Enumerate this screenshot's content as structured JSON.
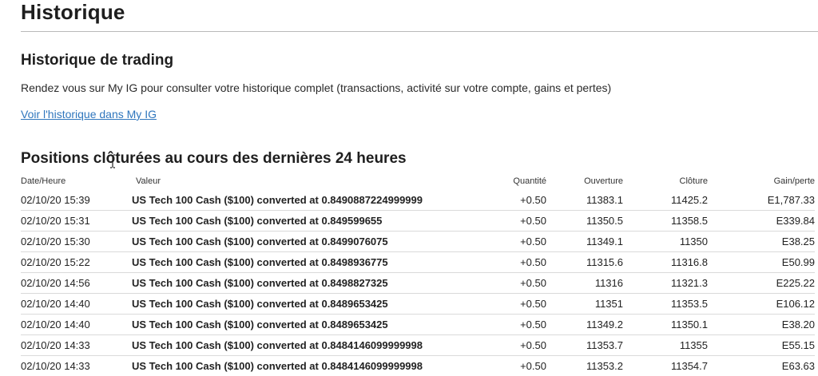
{
  "page": {
    "title": "Historique"
  },
  "trading_history": {
    "title": "Historique de trading",
    "description": "Rendez vous sur My IG pour consulter votre historique complet (transactions, activité sur votre compte, gains et pertes)",
    "link_label": "Voir l'historique dans My IG"
  },
  "positions": {
    "title": "Positions clôturées au cours des dernières 24 heures",
    "columns": {
      "date": "Date/Heure",
      "value": "Valeur",
      "quantity": "Quantité",
      "open": "Ouverture",
      "close": "Clôture",
      "gain": "Gain/perte"
    },
    "rows": [
      {
        "date": "02/10/20 15:39",
        "value": "US Tech 100 Cash ($100) converted at 0.8490887224999999",
        "quantity": "+0.50",
        "open": "11383.1",
        "close": "11425.2",
        "gain": "E1,787.33"
      },
      {
        "date": "02/10/20 15:31",
        "value": "US Tech 100 Cash ($100) converted at 0.849599655",
        "quantity": "+0.50",
        "open": "11350.5",
        "close": "11358.5",
        "gain": "E339.84"
      },
      {
        "date": "02/10/20 15:30",
        "value": "US Tech 100 Cash ($100) converted at 0.8499076075",
        "quantity": "+0.50",
        "open": "11349.1",
        "close": "11350",
        "gain": "E38.25"
      },
      {
        "date": "02/10/20 15:22",
        "value": "US Tech 100 Cash ($100) converted at 0.8498936775",
        "quantity": "+0.50",
        "open": "11315.6",
        "close": "11316.8",
        "gain": "E50.99"
      },
      {
        "date": "02/10/20 14:56",
        "value": "US Tech 100 Cash ($100) converted at 0.8498827325",
        "quantity": "+0.50",
        "open": "11316",
        "close": "11321.3",
        "gain": "E225.22"
      },
      {
        "date": "02/10/20 14:40",
        "value": "US Tech 100 Cash ($100) converted at 0.8489653425",
        "quantity": "+0.50",
        "open": "11351",
        "close": "11353.5",
        "gain": "E106.12"
      },
      {
        "date": "02/10/20 14:40",
        "value": "US Tech 100 Cash ($100) converted at 0.8489653425",
        "quantity": "+0.50",
        "open": "11349.2",
        "close": "11350.1",
        "gain": "E38.20"
      },
      {
        "date": "02/10/20 14:33",
        "value": "US Tech 100 Cash ($100) converted at 0.8484146099999998",
        "quantity": "+0.50",
        "open": "11353.7",
        "close": "11355",
        "gain": "E55.15"
      },
      {
        "date": "02/10/20 14:33",
        "value": "US Tech 100 Cash ($100) converted at 0.8484146099999998",
        "quantity": "+0.50",
        "open": "11353.2",
        "close": "11354.7",
        "gain": "E63.63"
      }
    ]
  },
  "colors": {
    "link_blue": "#2f76bd",
    "text_dark": "#1e1e1e",
    "row_border": "#dadada"
  },
  "icons": {
    "text_cursor": "text-cursor-icon"
  }
}
